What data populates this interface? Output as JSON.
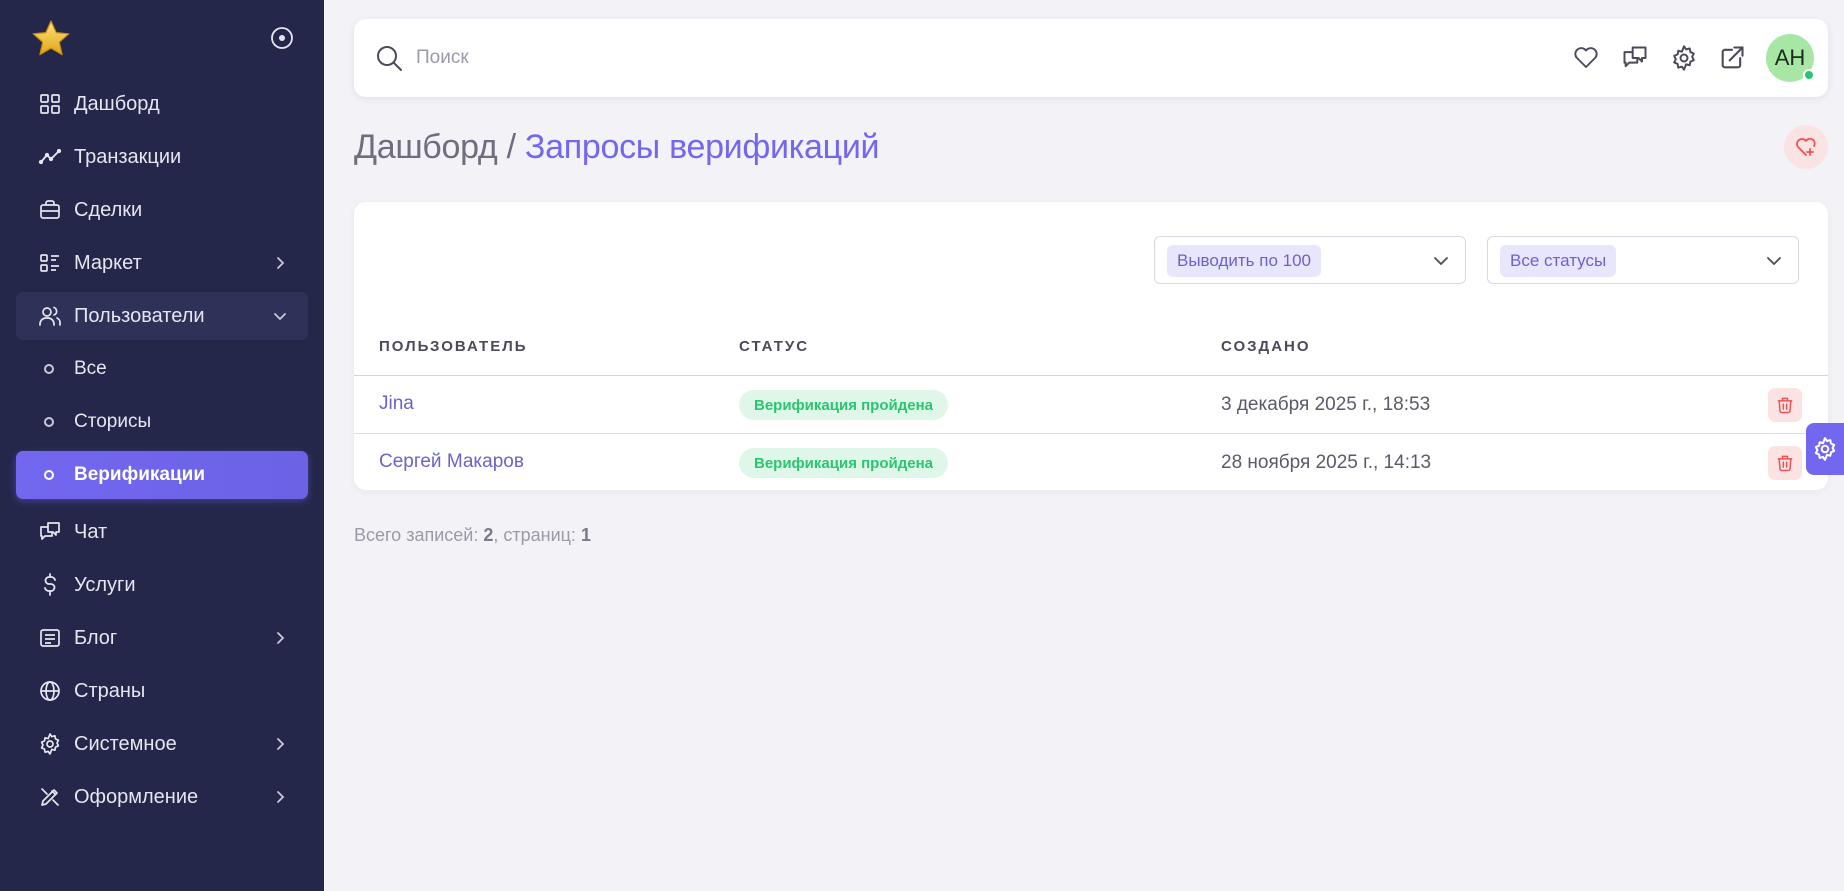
{
  "sidebar": {
    "items": [
      {
        "label": "Дашборд",
        "icon": "grid-icon"
      },
      {
        "label": "Транзакции",
        "icon": "trend-line-icon"
      },
      {
        "label": "Сделки",
        "icon": "briefcase-icon"
      },
      {
        "label": "Маркет",
        "icon": "list-details-icon"
      },
      {
        "label": "Пользователи",
        "icon": "users-icon"
      },
      {
        "label": "Чат",
        "icon": "messages-icon"
      },
      {
        "label": "Услуги",
        "icon": "dollar-icon"
      },
      {
        "label": "Блог",
        "icon": "article-icon"
      },
      {
        "label": "Страны",
        "icon": "globe-icon"
      },
      {
        "label": "Системное",
        "icon": "gear-icon"
      },
      {
        "label": "Оформление",
        "icon": "brush-icon"
      }
    ],
    "users_sub": [
      {
        "label": "Все"
      },
      {
        "label": "Сторисы"
      },
      {
        "label": "Верификации"
      }
    ],
    "accent": "#7367f0",
    "background": "#24264a"
  },
  "topbar": {
    "search_placeholder": "Поиск",
    "avatar_initials": "АН"
  },
  "page": {
    "breadcrumb_root": "Дашборд",
    "separator": " / ",
    "breadcrumb_current": "Запросы верификаций"
  },
  "filters": {
    "per_page": "Выводить по 100",
    "status": "Все статусы"
  },
  "table": {
    "headers": [
      "ПОЛЬЗОВАТЕЛЬ",
      "СТАТУС",
      "СОЗДАНО"
    ],
    "rows": [
      {
        "user": "Jina",
        "status": "Верификация пройдена",
        "created": "3 декабря 2025 г., 18:53"
      },
      {
        "user": "Сергей Макаров",
        "status": "Верификация пройдена",
        "created": "28 ноября 2025 г., 14:13"
      }
    ]
  },
  "footer": {
    "total_label": "Всего записей: ",
    "total": "2",
    "pages_label": ", страниц: ",
    "pages": "1"
  }
}
